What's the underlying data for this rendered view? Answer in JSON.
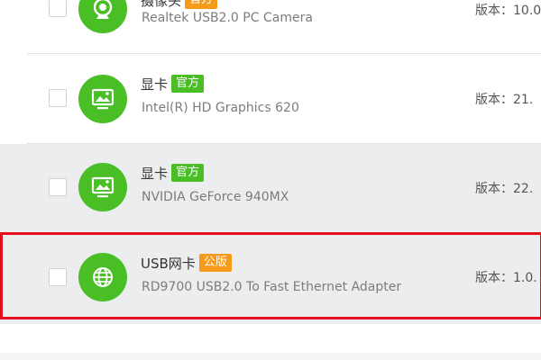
{
  "driver_list": {
    "items": [
      {
        "name": "摄像头",
        "tag": "官方",
        "device": "Realtek USB2.0 PC Camera",
        "version": "版本：10.0",
        "icon": "camera-icon"
      },
      {
        "name": "显卡",
        "tag": "官方",
        "device": "Intel(R) HD Graphics 620",
        "version": "版本：21.",
        "icon": "display-icon"
      },
      {
        "name": "显卡",
        "tag": "官方",
        "device": "NVIDIA GeForce 940MX",
        "version": "版本：22.",
        "icon": "display-icon"
      },
      {
        "name": "USB网卡",
        "tag": "公版",
        "device": "RD9700 USB2.0 To Fast Ethernet Adapter",
        "version": "版本：1.0.",
        "icon": "globe-icon"
      }
    ]
  },
  "colors": {
    "icon_green": "#49be25",
    "tag_official": "#49be25",
    "tag_generic": "#f59a19",
    "highlight_border": "#e60f1f",
    "row_alt_bg": "#ecedef"
  }
}
